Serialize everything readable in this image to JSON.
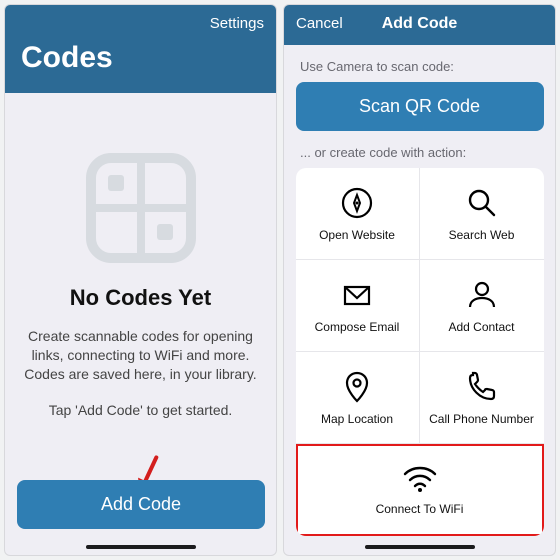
{
  "left": {
    "nav_settings": "Settings",
    "title": "Codes",
    "empty_title": "No Codes Yet",
    "empty_desc": "Create scannable codes for opening links, connecting to WiFi and more. Codes are saved here, in your library.",
    "empty_hint": "Tap 'Add Code' to get started.",
    "add_button": "Add Code"
  },
  "right": {
    "nav_cancel": "Cancel",
    "nav_title": "Add Code",
    "scan_label": "Use Camera to scan code:",
    "scan_button": "Scan QR Code",
    "create_label": "... or create code with action:",
    "actions": {
      "open_website": "Open Website",
      "search_web": "Search Web",
      "compose_email": "Compose Email",
      "add_contact": "Add Contact",
      "map_location": "Map Location",
      "call_phone": "Call Phone Number",
      "connect_wifi": "Connect To WiFi"
    }
  }
}
